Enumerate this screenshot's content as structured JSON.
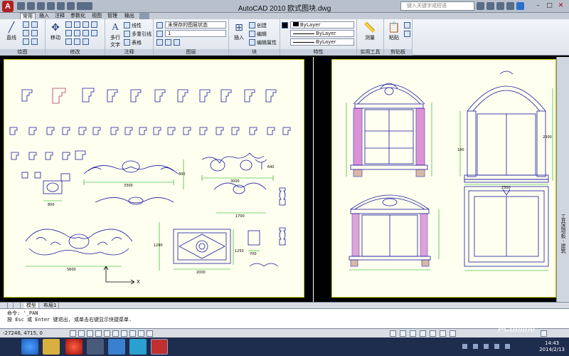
{
  "title": "AutoCAD 2010    欧式图块.dwg",
  "search_placeholder": "键入关键字或短语",
  "app_button": "A",
  "ribbon_tabs": [
    "常用",
    "插入",
    "注释",
    "参数化",
    "视图",
    "管理",
    "输出"
  ],
  "panels": {
    "draw": {
      "title": "绘图",
      "line": "直线"
    },
    "modify": {
      "title": "修改",
      "move": "移动"
    },
    "annotate": {
      "title": "注释",
      "multiline_text": "多行",
      "text": "文字",
      "linear": "线性",
      "multileader": "多重引线",
      "table": "表格"
    },
    "layers": {
      "title": "图层",
      "state": "未保存的图层状态",
      "layer_name": "1"
    },
    "block": {
      "title": "块",
      "insert": "插入",
      "create": "创建",
      "edit": "编辑",
      "edit_attr": "编辑属性"
    },
    "properties": {
      "title": "特性",
      "color": "ByLayer",
      "linetype": "ByLayer",
      "lineweight": "ByLayer"
    },
    "utilities": {
      "title": "实用工具",
      "measure": "测量"
    },
    "clipboard": {
      "title": "剪贴板",
      "paste": "粘贴"
    }
  },
  "palette_title": "工具选项板 - 建筑",
  "layout_tabs": [
    "模型",
    "布局1"
  ],
  "command_lines": [
    "命令: '_PAN",
    "按 Esc 或 Enter 键退出, 或单击右键显示快捷菜单."
  ],
  "coords": "-27246, 4715, 0",
  "dimensions": {
    "d3300": "3300",
    "d3000": "3000",
    "d800": "800",
    "d600": "600",
    "d640": "640",
    "d1700": "1700",
    "d700": "700",
    "d5600": "5600",
    "d2000": "2000",
    "d1250": "1250",
    "d1290": "1290",
    "d2000b": "2000",
    "d2300": "2300",
    "d1800": "180"
  },
  "clock": {
    "time": "14:43",
    "date": "2014/2/13"
  },
  "watermark": "PConline",
  "colors": {
    "paper": "#fffff0",
    "ink": "#1a1aa0",
    "accent_pink": "#cc66cc",
    "dim_green": "#00aa00"
  }
}
